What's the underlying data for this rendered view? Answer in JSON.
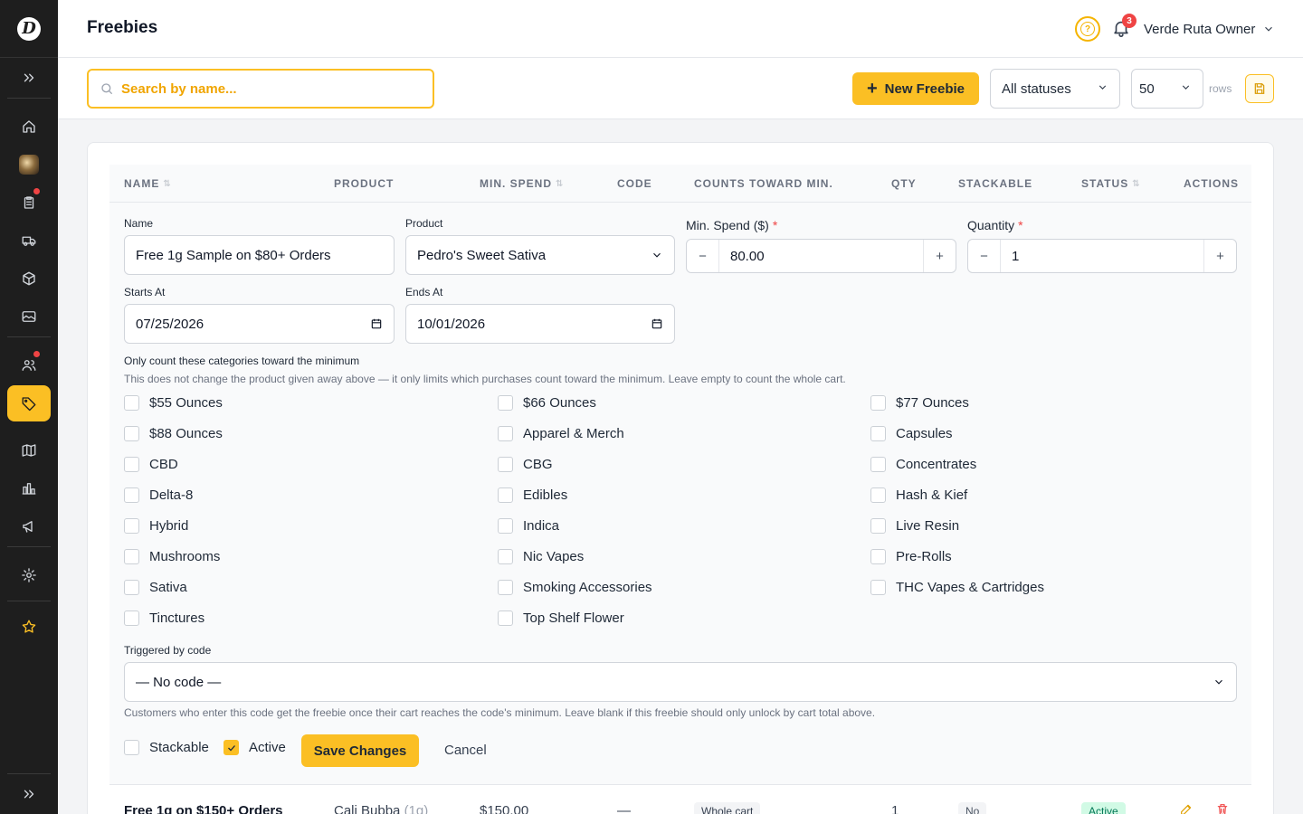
{
  "header": {
    "title": "Freebies",
    "notification_count": "3",
    "user_name": "Verde Ruta Owner",
    "help_icon_glyph": "?"
  },
  "toolbar": {
    "search_placeholder": "Search by name...",
    "new_button": "New Freebie",
    "status_filter": "All statuses",
    "rows_value": "50",
    "rows_label": "rows"
  },
  "table": {
    "columns": [
      "NAME",
      "PRODUCT",
      "MIN. SPEND",
      "CODE",
      "COUNTS TOWARD MIN.",
      "QTY",
      "STACKABLE",
      "STATUS",
      "ACTIONS"
    ],
    "rows": [
      {
        "name": "Free 1g on $150+ Orders",
        "product": "Cali Bubba",
        "product_size": "(1g)",
        "min_spend": "$150.00",
        "code": "—",
        "counts_toward": "Whole cart",
        "qty": "1",
        "stackable": "No",
        "status": "Active"
      }
    ]
  },
  "edit_form": {
    "name_label": "Name",
    "name_value": "Free 1g Sample on $80+ Orders",
    "product_label": "Product",
    "product_value": "Pedro's Sweet Sativa",
    "min_spend_label": "Min. Spend ($)",
    "min_spend_value": "80.00",
    "quantity_label": "Quantity",
    "quantity_value": "1",
    "required_mark": "*",
    "minus": "−",
    "plus": "+",
    "starts_label": "Starts At",
    "starts_value": "07/25/2026",
    "ends_label": "Ends At",
    "ends_value": "10/01/2026",
    "categories_label": "Only count these categories toward the minimum",
    "categories_help": "This does not change the product given away above — it only limits which purchases count toward the minimum. Leave empty to count the whole cart.",
    "categories": [
      "$55 Ounces",
      "$66 Ounces",
      "$77 Ounces",
      "$88 Ounces",
      "Apparel & Merch",
      "Capsules",
      "CBD",
      "CBG",
      "Concentrates",
      "Delta-8",
      "Edibles",
      "Hash & Kief",
      "Hybrid",
      "Indica",
      "Live Resin",
      "Mushrooms",
      "Nic Vapes",
      "Pre-Rolls",
      "Sativa",
      "Smoking Accessories",
      "THC Vapes & Cartridges",
      "Tinctures",
      "Top Shelf Flower"
    ],
    "code_label": "Triggered by code",
    "code_value": "— No code —",
    "code_help": "Customers who enter this code get the freebie once their cart reaches the code's minimum. Leave blank if this freebie should only unlock by cart total above.",
    "stackable_label": "Stackable",
    "stackable_checked": false,
    "active_label": "Active",
    "active_checked": true,
    "save_label": "Save Changes",
    "cancel_label": "Cancel"
  },
  "sidebar": {
    "items": [
      {
        "icon": "expand-icon"
      },
      {
        "icon": "home-icon"
      },
      {
        "icon": "store-avatar"
      },
      {
        "icon": "clipboard-icon",
        "dot": true
      },
      {
        "icon": "truck-icon"
      },
      {
        "icon": "box-icon"
      },
      {
        "icon": "image-icon"
      },
      {
        "icon": "users-icon",
        "dot": true
      },
      {
        "icon": "tag-icon",
        "active": true
      },
      {
        "icon": "book-icon"
      },
      {
        "icon": "chart-icon"
      },
      {
        "icon": "megaphone-icon"
      },
      {
        "icon": "gear-icon"
      },
      {
        "icon": "star-icon"
      },
      {
        "icon": "collapse-icon"
      }
    ]
  },
  "colors": {
    "accent": "#fbbf24",
    "sidebar_bg": "#1e1e1e",
    "danger": "#ef4444",
    "active_pill_bg": "#d1fae5",
    "active_pill_text": "#047857"
  }
}
